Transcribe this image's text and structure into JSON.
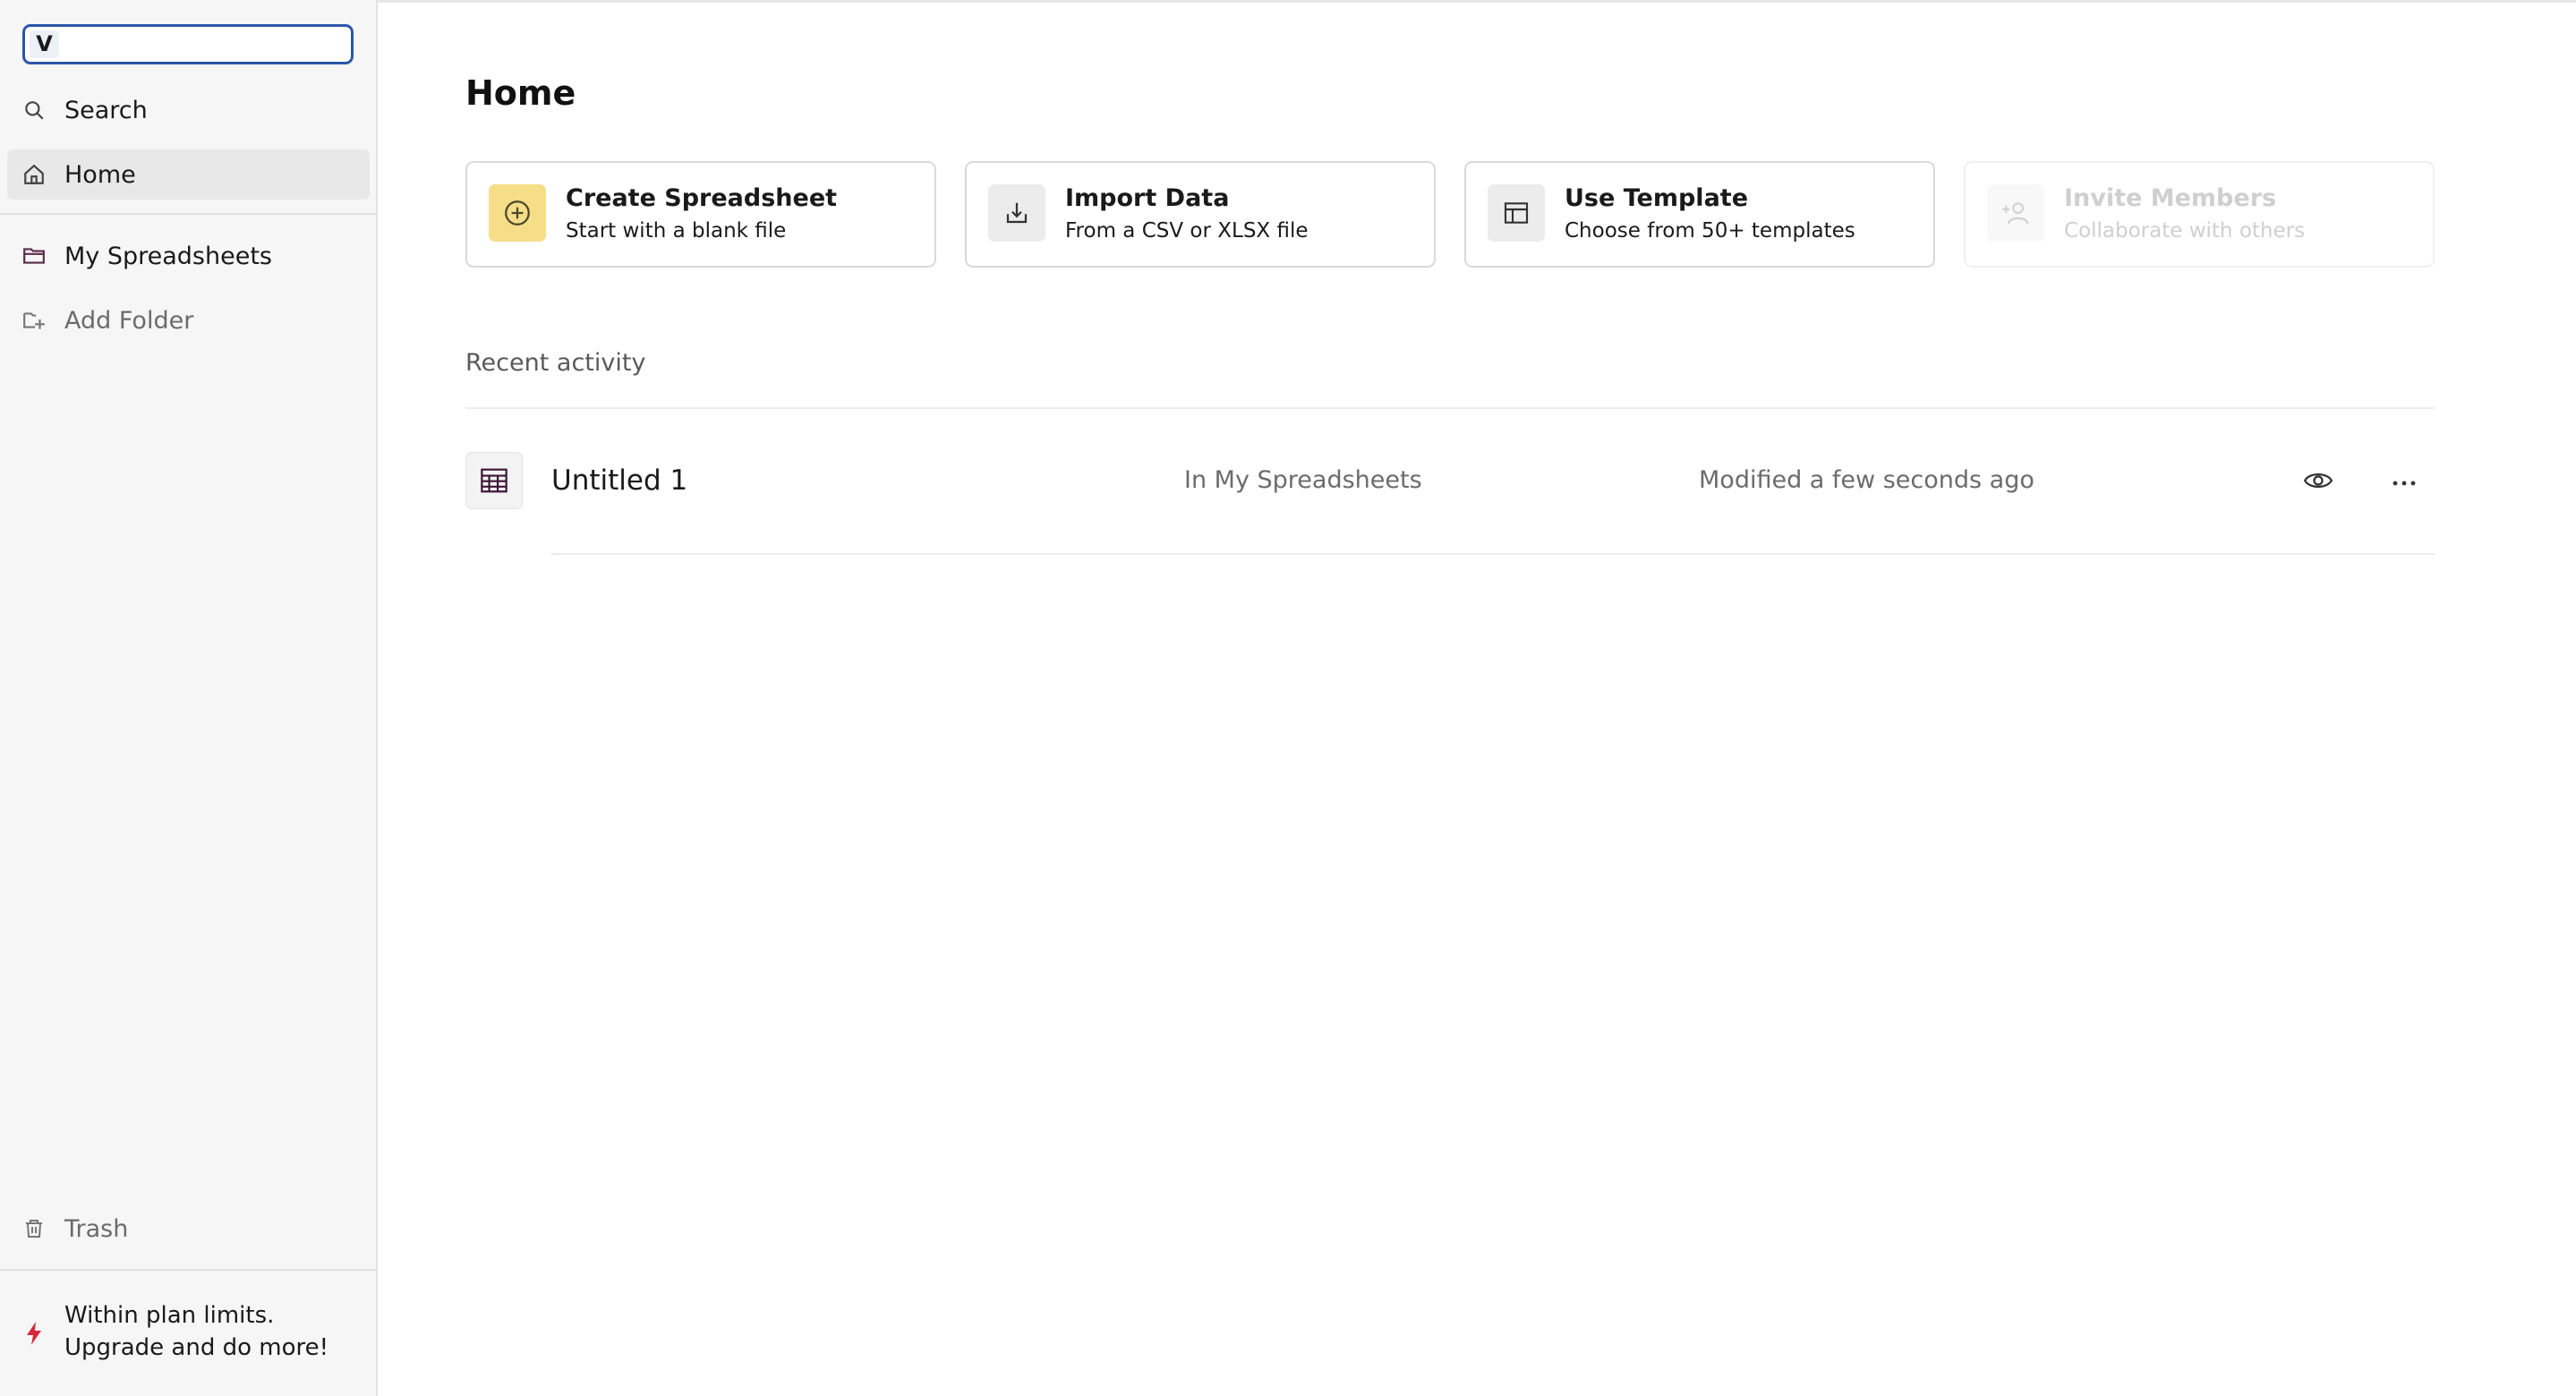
{
  "workspace": {
    "badge": "V",
    "value": ""
  },
  "sidebar": {
    "search_label": "Search",
    "home_label": "Home",
    "my_spreadsheets_label": "My Spreadsheets",
    "add_folder_label": "Add Folder",
    "trash_label": "Trash",
    "upgrade_line1": "Within plan limits.",
    "upgrade_line2": "Upgrade and do more!"
  },
  "main": {
    "title": "Home",
    "cards": [
      {
        "title": "Create Spreadsheet",
        "subtitle": "Start with a blank file",
        "icon": "plus-circle-icon",
        "enabled": true
      },
      {
        "title": "Import Data",
        "subtitle": "From a CSV or XLSX file",
        "icon": "download-tray-icon",
        "enabled": true
      },
      {
        "title": "Use Template",
        "subtitle": "Choose from 50+ templates",
        "icon": "layout-template-icon",
        "enabled": true
      },
      {
        "title": "Invite Members",
        "subtitle": "Collaborate with others",
        "icon": "user-plus-icon",
        "enabled": false
      }
    ],
    "recent_label": "Recent activity",
    "recent": [
      {
        "name": "Untitled 1",
        "location": "In My Spreadsheets",
        "modified": "Modified a few seconds ago",
        "icon": "spreadsheet-icon"
      }
    ]
  },
  "colors": {
    "accent": "#2b56a8",
    "create_icon_bg": "#f6de88",
    "upgrade_icon": "#d6283a"
  }
}
